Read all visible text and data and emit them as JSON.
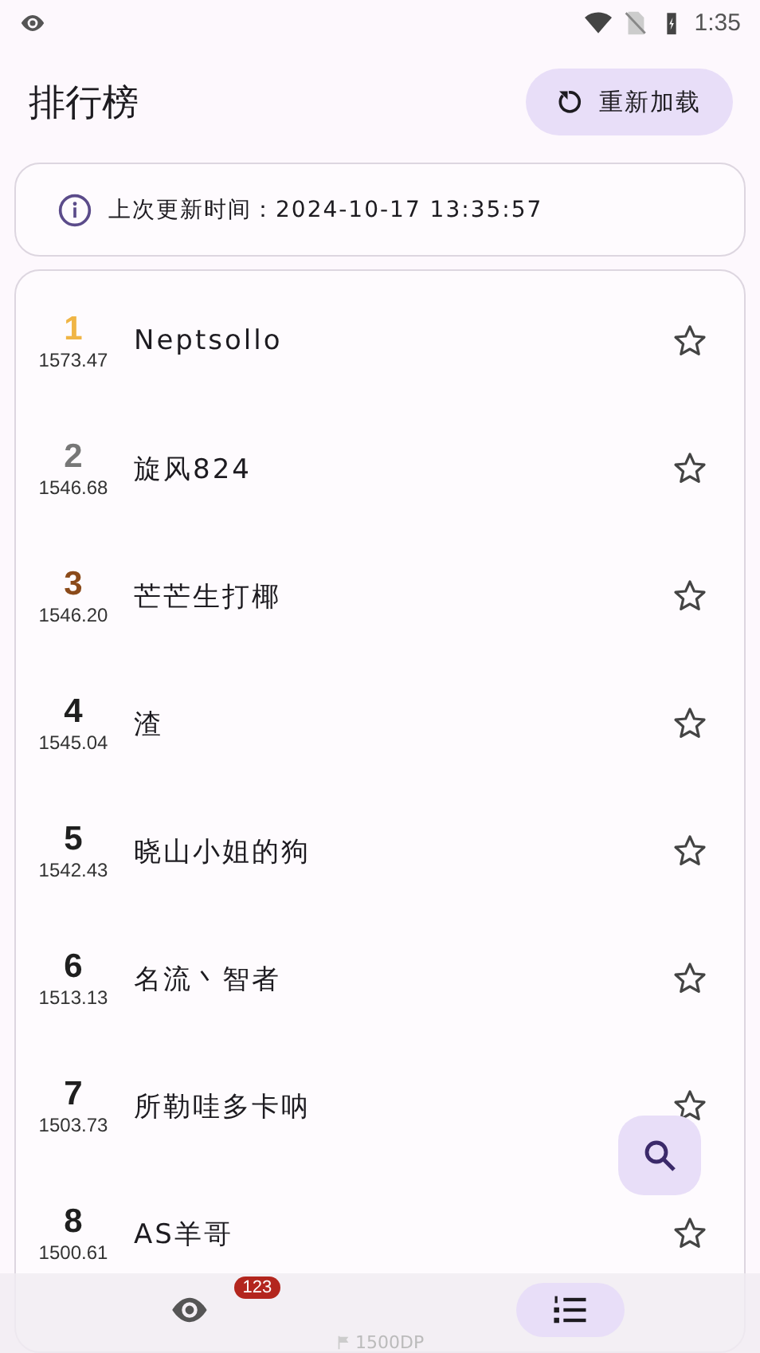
{
  "status_bar": {
    "time": "1:35"
  },
  "header": {
    "title": "排行榜",
    "reload_button": "重新加载"
  },
  "info": {
    "text": "上次更新时间：2024-10-17 13:35:57"
  },
  "ranking": [
    {
      "rank": "1",
      "score": "1573.47",
      "name": "Neptsollo",
      "color": "#f0b545"
    },
    {
      "rank": "2",
      "score": "1546.68",
      "name": "旋风824",
      "color": "#777777"
    },
    {
      "rank": "3",
      "score": "1546.20",
      "name": "芒芒生打椰",
      "color": "#8b4a1a"
    },
    {
      "rank": "4",
      "score": "1545.04",
      "name": "渣",
      "color": "#1f1f1f"
    },
    {
      "rank": "5",
      "score": "1542.43",
      "name": "晓山小姐的狗",
      "color": "#1f1f1f"
    },
    {
      "rank": "6",
      "score": "1513.13",
      "name": "名流丶智者",
      "color": "#1f1f1f"
    },
    {
      "rank": "7",
      "score": "1503.73",
      "name": "所勒哇多卡呐",
      "color": "#1f1f1f"
    },
    {
      "rank": "8",
      "score": "1500.61",
      "name": "AS羊哥",
      "color": "#1f1f1f"
    }
  ],
  "bottom_nav": {
    "items": [
      {
        "kind": "watch",
        "badge": "123",
        "selected": false
      },
      {
        "kind": "ranking",
        "selected": true
      }
    ],
    "caption": "1500DP"
  }
}
